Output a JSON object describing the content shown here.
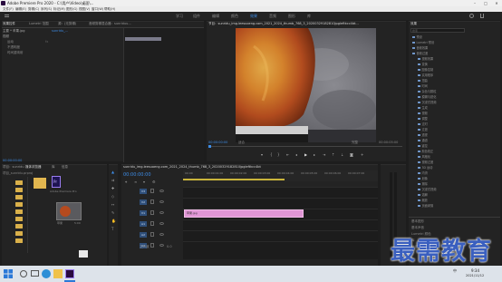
{
  "window": {
    "title": "Adobe Premiere Pro 2020 - C:\\用户\\Video\\桌面\\...",
    "controls": [
      "–",
      "□",
      "✕"
    ]
  },
  "menu": [
    "文件(F)",
    "编辑(E)",
    "剪辑(C)",
    "序列(S)",
    "标记(M)",
    "图形(G)",
    "视图(V)",
    "窗口(W)",
    "帮助(H)"
  ],
  "workspaces": [
    "学习",
    "组件",
    "编辑",
    "颜色",
    "效果",
    "音频",
    "图形",
    "库"
  ],
  "active_workspace": "效果",
  "left_panel": {
    "tabs": [
      "效果控件",
      "Lumetri 范围",
      "源：(无剪辑)",
      "音频剪辑混合器：sunriduu..."
    ],
    "source_label": "主要 * 苹果.jpg",
    "sequence_label": "sunridu_...",
    "rows": [
      "视频",
      "运动",
      "不透明度",
      "时间重映射"
    ],
    "timecode": "00:00:00:00"
  },
  "program_monitor": {
    "tab": "节目：sunridu_img.leesuoeng.com_2021_2024_thumb_768_3_20200329182810jpgleftkcc4bt...",
    "timecode_left": "00:00:00:00",
    "fit": "适合",
    "quality": "完整",
    "timecode_right": "00:00:05:00"
  },
  "project_panel": {
    "tabs": [
      "项目：sunridu",
      "媒体浏览器",
      "库",
      "信息"
    ],
    "path": "项目_sunridu.prproj",
    "items": [
      {
        "name": "Adobe Premiere Pro",
        "sub": ""
      },
      {
        "name": "苹果",
        "sub": "5:00"
      },
      {
        "name": "sunridu...",
        "sub": ""
      }
    ]
  },
  "timeline": {
    "tab": "sunridu_img.leesuoeng.com_2021_2024_thumb_768_3_20200329182810jpgleftkcc4bt",
    "timecode": "00:00:00:00",
    "ruler": [
      "00:00",
      "00:00:01:00",
      "00:00:02:00",
      "00:00:03:00",
      "00:00:04:00",
      "00:00:05:00",
      "00:00:06:00",
      "00:00:07:00"
    ],
    "tracks": [
      "V3",
      "V2",
      "V1",
      "A1",
      "A2",
      "A3"
    ],
    "master": "主声道",
    "master_value": "0.0",
    "clip_label": "苹果.jpg"
  },
  "effects_panel": {
    "tab": "效果",
    "search_placeholder": "搜索",
    "items": [
      "预设",
      "Lumetri 预设",
      "音频效果",
      "音频过渡",
      "视频效果",
      "变换",
      "图像控制",
      "实用程序",
      "扭曲",
      "时间",
      "杂色与颗粒",
      "模糊与锐化",
      "沉浸式视频",
      "生成",
      "视频",
      "调整",
      "过时",
      "过渡",
      "透视",
      "通道",
      "键控",
      "颜色校正",
      "风格化",
      "视频过渡",
      "3D 运动",
      "内滑",
      "划像",
      "擦除",
      "沉浸式视频",
      "溶解",
      "缩放",
      "页面剥落"
    ],
    "bottom": [
      "基本图形",
      "基本声音",
      "Lumetri 颜色",
      "库",
      "标记"
    ]
  },
  "watermark": "最需教育",
  "taskbar": {
    "time": "9:34",
    "date": "2021/11/12",
    "lang": "中"
  }
}
